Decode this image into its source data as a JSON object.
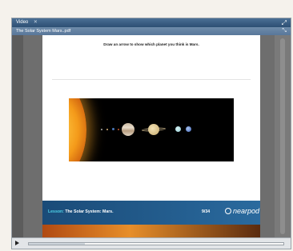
{
  "window": {
    "title": "Video",
    "title_close": "✕",
    "maximize_icon": "⤢"
  },
  "file": {
    "name": "The Solar System Mars..pdf",
    "expand_icon": "⤡"
  },
  "slide": {
    "instruction": "Draw an arrow to show which planet you think is Mars.",
    "lesson_key": "Lesson:",
    "lesson_title": "The Solar System: Mars.",
    "page_count": "9/34",
    "brand": "nearpod"
  },
  "player": {
    "play_icon": "play-icon",
    "progress": 0.22
  }
}
